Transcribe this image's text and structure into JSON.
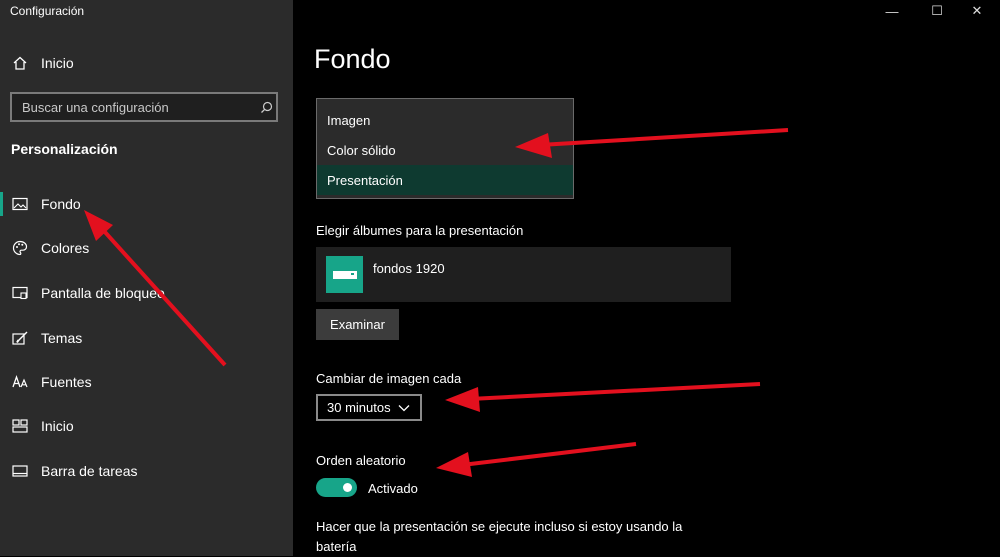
{
  "window": {
    "title": "Configuración",
    "minimize_glyph": "—",
    "maximize_glyph": "☐",
    "close_glyph": "✕"
  },
  "sidebar": {
    "home_label": "Inicio",
    "search_placeholder": "Buscar una configuración",
    "section_title": "Personalización",
    "items": [
      {
        "label": "Fondo",
        "icon": "image-icon",
        "selected": true
      },
      {
        "label": "Colores",
        "icon": "palette-icon"
      },
      {
        "label": "Pantalla de bloqueo",
        "icon": "lock-screen-icon"
      },
      {
        "label": "Temas",
        "icon": "themes-icon"
      },
      {
        "label": "Fuentes",
        "icon": "fonts-icon"
      },
      {
        "label": "Inicio",
        "icon": "start-icon"
      },
      {
        "label": "Barra de tareas",
        "icon": "taskbar-icon"
      }
    ]
  },
  "main": {
    "title": "Fondo",
    "background_options": [
      "Imagen",
      "Color sólido",
      "Presentación"
    ],
    "background_selected": "Presentación",
    "albums_label": "Elegir álbumes para la presentación",
    "album_name": "fondos 1920",
    "browse_button": "Examinar",
    "interval_label": "Cambiar de imagen cada",
    "interval_value": "30 minutos",
    "shuffle_label": "Orden aleatorio",
    "shuffle_state": "Activado",
    "battery_label": "Hacer que la presentación se ejecute incluso si estoy usando la batería"
  },
  "colors": {
    "accent": "#17a589",
    "annotation_arrow": "#e3101e"
  }
}
